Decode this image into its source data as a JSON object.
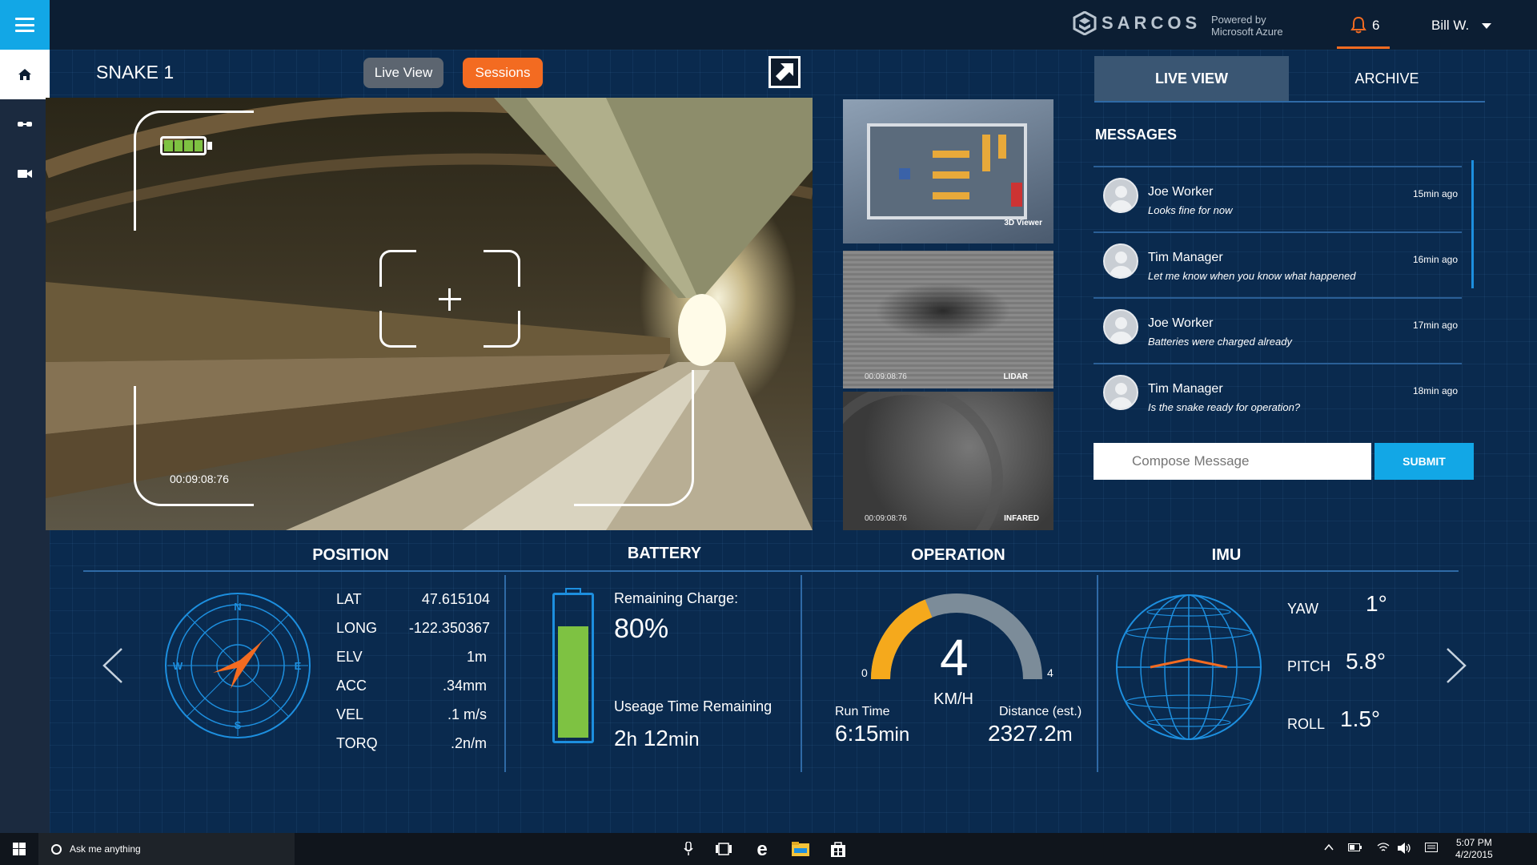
{
  "header": {
    "brand": "SARCOS",
    "powered_line1": "Powered by",
    "powered_line2": "Microsoft Azure",
    "notification_count": "6",
    "user_name": "Bill W."
  },
  "toolbar": {
    "title": "SNAKE 1",
    "live_view_label": "Live View",
    "sessions_label": "Sessions"
  },
  "camera": {
    "timestamp": "00:09:08:76"
  },
  "thumbnails": [
    {
      "label": "3D Viewer",
      "timestamp": ""
    },
    {
      "label": "LIDAR",
      "timestamp": "00:09:08:76"
    },
    {
      "label": "INFARED",
      "timestamp": "00:09:08:76"
    }
  ],
  "panel": {
    "tab_live": "LIVE VIEW",
    "tab_archive": "ARCHIVE",
    "messages_title": "MESSAGES",
    "messages": [
      {
        "name": "Joe Worker",
        "text": "Looks fine for now",
        "time": "15min ago"
      },
      {
        "name": "Tim Manager",
        "text": "Let me know when you know what happened",
        "time": "16min ago"
      },
      {
        "name": "Joe Worker",
        "text": "Batteries were charged already",
        "time": "17min ago"
      },
      {
        "name": "Tim Manager",
        "text": "Is the snake ready for operation?",
        "time": "18min ago"
      }
    ],
    "compose_placeholder": "Compose Message",
    "submit_label": "SUBMIT"
  },
  "position": {
    "title": "POSITION",
    "compass": {
      "n": "N",
      "s": "S",
      "e": "E",
      "w": "W"
    },
    "rows": [
      {
        "label": "LAT",
        "value": "47.615104"
      },
      {
        "label": "LONG",
        "value": "-122.350367"
      },
      {
        "label": "ELV",
        "value": "1m"
      },
      {
        "label": "ACC",
        "value": ".34mm"
      },
      {
        "label": "VEL",
        "value": ".1 m/s"
      },
      {
        "label": "TORQ",
        "value": ".2n/m"
      }
    ]
  },
  "battery": {
    "title": "BATTERY",
    "charge_label": "Remaining Charge:",
    "charge_value": "80%",
    "charge_fraction": 0.8,
    "usage_label": "Useage Time Remaining",
    "usage_hours": "2",
    "usage_hours_unit": "h",
    "usage_minutes": "12",
    "usage_minutes_unit": "min"
  },
  "operation": {
    "title": "OPERATION",
    "speed": "4",
    "speed_unit": "KM/H",
    "gauge_min": "0",
    "gauge_max": "4",
    "gauge_fill_fraction": 0.38,
    "run_time_label": "Run Time",
    "run_time_value": "6:15",
    "run_time_unit": "min",
    "distance_label": "Distance (est.)",
    "distance_value": "2327.2",
    "distance_unit": "m"
  },
  "imu": {
    "title": "IMU",
    "rows": [
      {
        "label": "YAW",
        "value": "1°"
      },
      {
        "label": "PITCH",
        "value": "5.8°"
      },
      {
        "label": "ROLL",
        "value": "1.5°"
      }
    ]
  },
  "taskbar": {
    "search_placeholder": "Ask me anything",
    "time": "5:07 PM",
    "date": "4/2/2015"
  },
  "colors": {
    "accent_blue": "#12a7e6",
    "accent_orange": "#f36b21",
    "battery_green": "#7ec242",
    "gauge_yellow": "#f5a91c"
  }
}
